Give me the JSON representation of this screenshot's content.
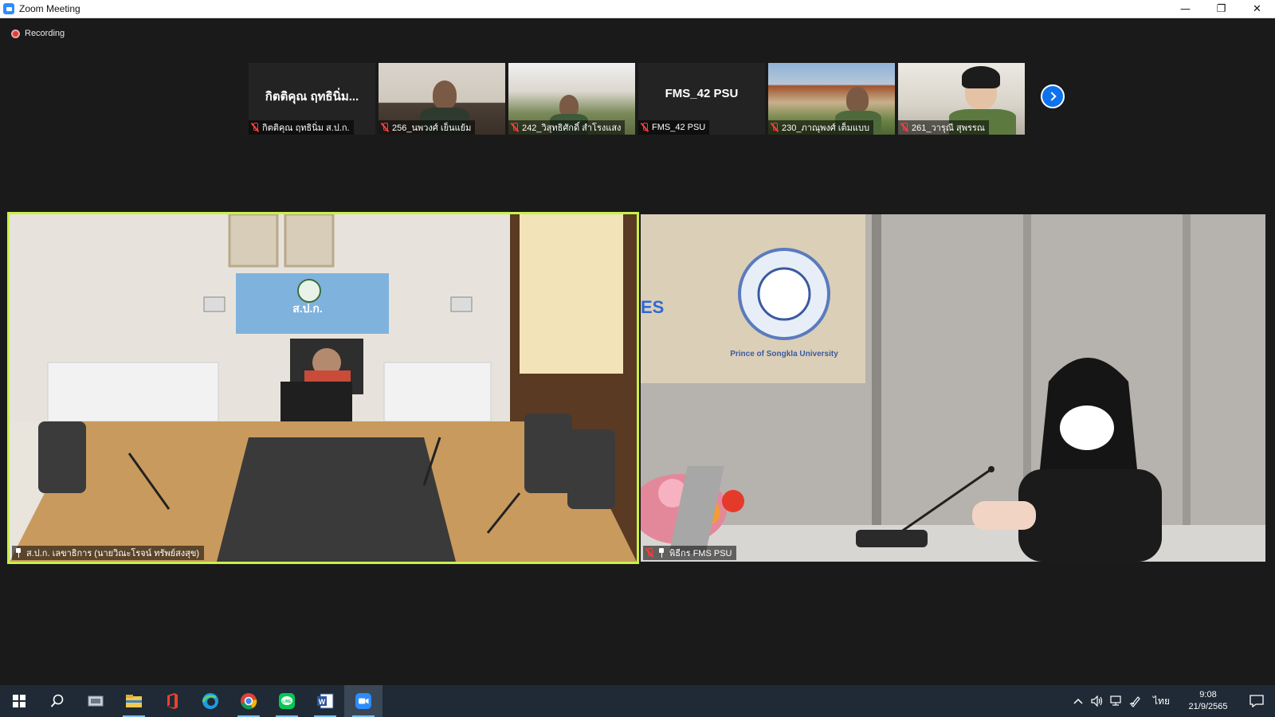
{
  "window": {
    "title": "Zoom Meeting",
    "minimize": "—",
    "maximize": "❐",
    "close": "✕"
  },
  "recording": {
    "label": "Recording"
  },
  "thumbnails": [
    {
      "card_text": "กิตติคุณ ฤทธินิ่ม...",
      "label": "กิตติคุณ ฤทธินิ่ม ส.ป.ก.",
      "muted": true
    },
    {
      "card_text": "",
      "label": "256_นพวงศ์ เย็นแย้ม",
      "muted": true
    },
    {
      "card_text": "",
      "label": "242_วิสุทธิศักดิ์ สำโรงแสง",
      "muted": true
    },
    {
      "card_text": "FMS_42 PSU",
      "label": "FMS_42 PSU",
      "muted": true
    },
    {
      "card_text": "",
      "label": "230_ภาณุพงศ์ เต็มแบบ",
      "muted": true
    },
    {
      "card_text": "",
      "label": "261_วารุณี สุพรรณ",
      "muted": true
    }
  ],
  "main_videos": [
    {
      "label": "ส.ป.ก. เลขาธิการ (นายวิณะโรจน์ ทรัพย์สงสุข)",
      "muted": false,
      "pinned": true,
      "active_speaker": true
    },
    {
      "label": "พิธีกร FMS PSU",
      "muted": true,
      "pinned": true,
      "active_speaker": false
    }
  ],
  "scene_text": {
    "banner": "ส.ป.ก.",
    "university": "Prince of Songkla University",
    "partial_sign": "ES"
  },
  "taskbar": {
    "apps": [
      "start",
      "search",
      "task-view",
      "file-explorer",
      "office",
      "edge",
      "chrome",
      "line",
      "word",
      "zoom"
    ],
    "lang": "ไทย",
    "time": "9:08",
    "date": "21/9/2565"
  },
  "colors": {
    "active_speaker_border": "#c9f04a",
    "zoom_blue": "#0e72ed",
    "mute_red": "#ff3b3b",
    "taskbar_bg": "#1f2a36"
  }
}
